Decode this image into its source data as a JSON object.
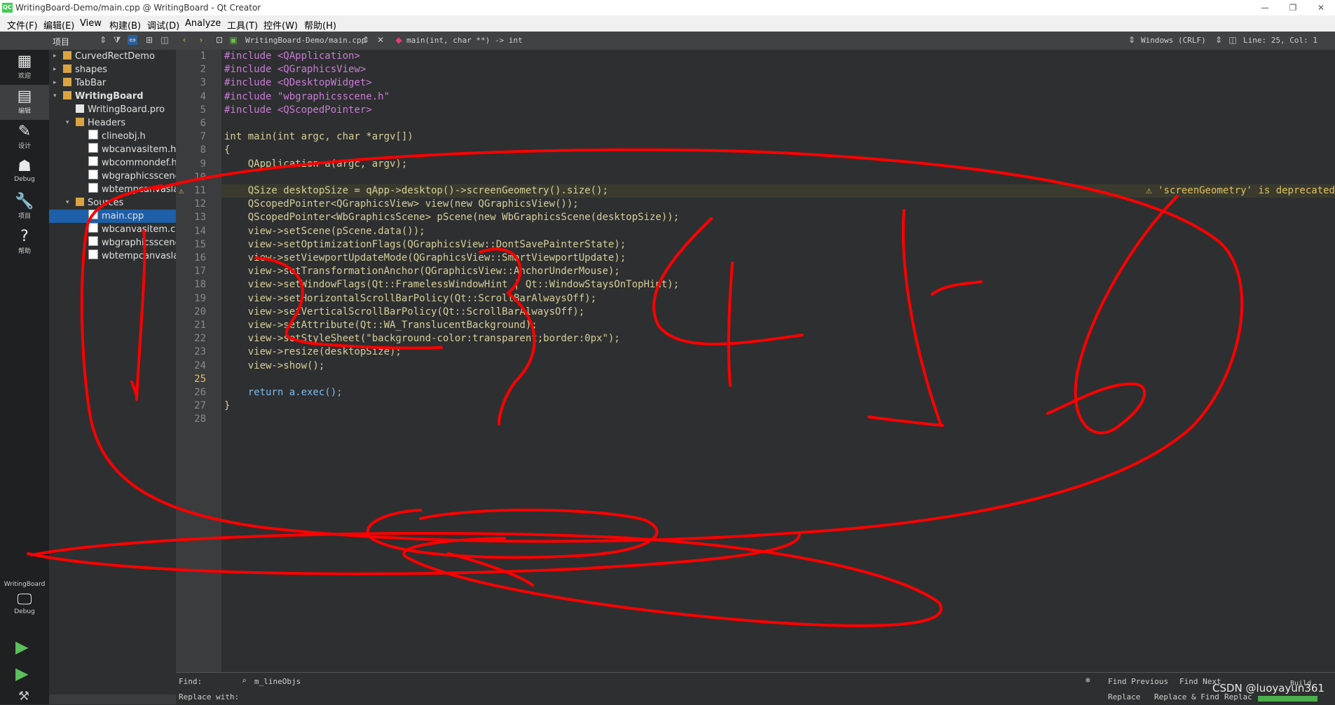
{
  "window": {
    "app_icon": "QC",
    "title": "WritingBoard-Demo/main.cpp @ WritingBoard - Qt Creator",
    "controls": [
      "—",
      "❐",
      "✕"
    ]
  },
  "menu": [
    "文件(F)",
    "编辑(E)",
    "View",
    "构建(B)",
    "调试(D)",
    "Analyze",
    "工具(T)",
    "控件(W)",
    "帮助(H)"
  ],
  "toolbar": {
    "project_selector": "项目",
    "file_path": "WritingBoard-Demo/main.cpp",
    "function": "main(int, char **) -> int",
    "line_ending": "Windows (CRLF)",
    "position": "Line: 25, Col: 1"
  },
  "modes": [
    {
      "icon": "grid-icon",
      "label": "欢迎",
      "glyph": "▦"
    },
    {
      "icon": "edit-icon",
      "label": "编辑",
      "glyph": "▤"
    },
    {
      "icon": "design-icon",
      "label": "设计",
      "glyph": "✎"
    },
    {
      "icon": "debug-icon",
      "label": "Debug",
      "glyph": "☗"
    },
    {
      "icon": "projects-icon",
      "label": "项目",
      "glyph": "🔧"
    },
    {
      "icon": "help-icon",
      "label": "帮助",
      "glyph": "?"
    }
  ],
  "kit": {
    "project": "WritingBoard",
    "mode": "Debug"
  },
  "tree": [
    {
      "label": "CurvedRectDemo",
      "level": 0,
      "type": "folder",
      "expanded": false
    },
    {
      "label": "shapes",
      "level": 0,
      "type": "folder",
      "expanded": false
    },
    {
      "label": "TabBar",
      "level": 0,
      "type": "folder",
      "expanded": false
    },
    {
      "label": "WritingBoard",
      "level": 0,
      "type": "folder",
      "expanded": true,
      "bold": true
    },
    {
      "label": "WritingBoard.pro",
      "level": 1,
      "type": "pro"
    },
    {
      "label": "Headers",
      "level": 1,
      "type": "folder",
      "expanded": true
    },
    {
      "label": "clineobj.h",
      "level": 2,
      "type": "file"
    },
    {
      "label": "wbcanvasitem.h",
      "level": 2,
      "type": "file"
    },
    {
      "label": "wbcommondef.h",
      "level": 2,
      "type": "file"
    },
    {
      "label": "wbgraphicsscene",
      "level": 2,
      "type": "file"
    },
    {
      "label": "wbtempcanvaslay",
      "level": 2,
      "type": "file"
    },
    {
      "label": "Sources",
      "level": 1,
      "type": "folder",
      "expanded": true
    },
    {
      "label": "main.cpp",
      "level": 2,
      "type": "file",
      "selected": true
    },
    {
      "label": "wbcanvasitem.cpp",
      "level": 2,
      "type": "file"
    },
    {
      "label": "wbgraphicsscene",
      "level": 2,
      "type": "file"
    },
    {
      "label": "wbtempcanvaslay",
      "level": 2,
      "type": "file"
    }
  ],
  "editor": {
    "current_line": 25,
    "warning_line": 11,
    "warning_message": "'screenGeometry' is deprecated",
    "lines": [
      "#include <QApplication>",
      "#include <QGraphicsView>",
      "#include <QDesktopWidget>",
      "#include \"wbgraphicsscene.h\"",
      "#include <QScopedPointer>",
      "",
      "int main(int argc, char *argv[])",
      "{",
      "    QApplication a(argc, argv);",
      "",
      "    QSize desktopSize = qApp->desktop()->screenGeometry().size();",
      "    QScopedPointer<QGraphicsView> view(new QGraphicsView());",
      "    QScopedPointer<WbGraphicsScene> pScene(new WbGraphicsScene(desktopSize));",
      "    view->setScene(pScene.data());",
      "    view->setOptimizationFlags(QGraphicsView::DontSavePainterState);",
      "    view->setViewportUpdateMode(QGraphicsView::SmartViewportUpdate);",
      "    view->setTransformationAnchor(QGraphicsView::AnchorUnderMouse);",
      "    view->setWindowFlags(Qt::FramelessWindowHint | Qt::WindowStaysOnTopHint);",
      "    view->setHorizontalScrollBarPolicy(Qt::ScrollBarAlwaysOff);",
      "    view->setVerticalScrollBarPolicy(Qt::ScrollBarAlwaysOff);",
      "    view->setAttribute(Qt::WA_TranslucentBackground);",
      "    view->setStyleSheet(\"background-color:transparent;border:0px\");",
      "    view->resize(desktopSize);",
      "    view->show();",
      "",
      "    return a.exec();",
      "}",
      ""
    ]
  },
  "find": {
    "find_label": "Find:",
    "replace_label": "Replace with:",
    "query": "m_lineObjs",
    "find_previous": "Find Previous",
    "find_next": "Find Next",
    "replace": "Replace",
    "replace_find": "Replace & Find",
    "replace_all": "Replac",
    "build_label": "Build"
  },
  "watermark": "CSDN @luoyayun361",
  "colors": {
    "ink": "#ff0000",
    "editor_bg": "#2e2f30",
    "selection": "#1d5fa8"
  }
}
